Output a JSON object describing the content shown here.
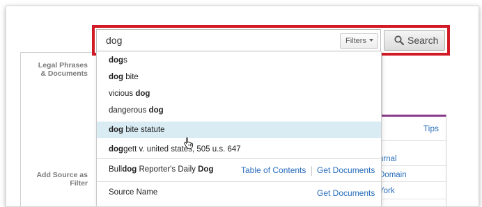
{
  "search": {
    "query": "dog",
    "filters_label": "Filters",
    "search_label": "Search"
  },
  "sidebar": {
    "legal_phrases_line1": "Legal Phrases",
    "legal_phrases_line2": "& Documents",
    "add_source_line1": "Add Source as",
    "add_source_line2": "Filter"
  },
  "right_card": {
    "tips": "Tips",
    "links": [
      "urnal",
      "Domain",
      "York"
    ]
  },
  "suggestions": [
    {
      "bold": "dog",
      "rest": "s"
    },
    {
      "bold": "dog",
      "rest": " bite"
    },
    {
      "pre": "vicious ",
      "bold": "dog"
    },
    {
      "pre": "dangerous ",
      "bold": "dog"
    },
    {
      "bold": "dog",
      "rest": " bite statute"
    },
    {
      "bold": "dog",
      "rest": "gett v. united states, 505 u.s. 647"
    }
  ],
  "sources": [
    {
      "pre": "Bull",
      "bold": "dog",
      "mid": " Reporter's Daily ",
      "bold2": "Dog",
      "toc": "Table of Contents",
      "get": "Get Documents"
    },
    {
      "name": "Source Name",
      "get": "Get Documents"
    }
  ],
  "colors": {
    "highlight_outline": "#d11a26",
    "link": "#2a6ebb",
    "row_highlight": "#d9ecf4",
    "card_accent": "#8a3a8a"
  }
}
